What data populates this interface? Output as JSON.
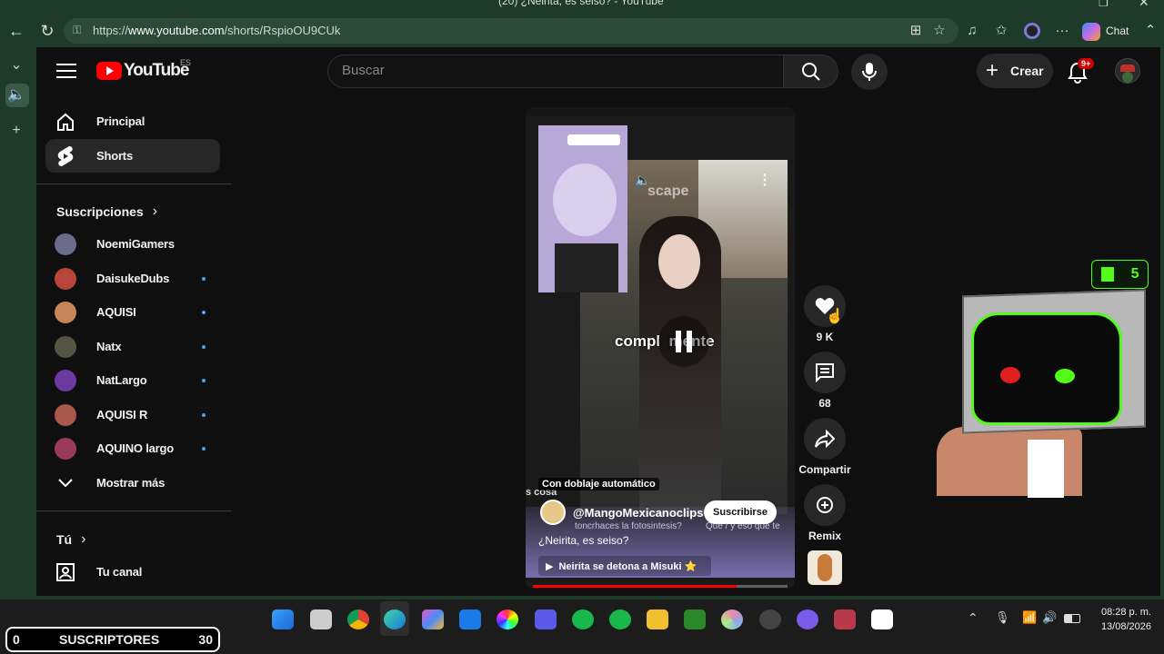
{
  "browser": {
    "tab_title": "(20) ¿Neirita, es seiso? - YouTube",
    "url": "https://www.youtube.com/shorts/RspioOU9CUk",
    "url_host": "www.youtube.com",
    "chat_label": "Chat"
  },
  "youtube": {
    "logo_text": "YouTube",
    "country": "ES",
    "search_placeholder": "Buscar",
    "create_label": "Crear",
    "notif_badge": "9+"
  },
  "sidebar": {
    "main": [
      {
        "label": "Principal",
        "icon": "home-icon"
      },
      {
        "label": "Shorts",
        "icon": "shorts-icon",
        "active": true
      }
    ],
    "subscriptions_title": "Suscripciones",
    "subscriptions": [
      {
        "label": "NoemiGamers",
        "dot": false,
        "color": "#6b6b8a"
      },
      {
        "label": "DaisukeDubs",
        "dot": true,
        "color": "#b8443a"
      },
      {
        "label": "AQUISI",
        "dot": true,
        "color": "#c9845a"
      },
      {
        "label": "Natx",
        "dot": true,
        "color": "#555544"
      },
      {
        "label": "NatLargo",
        "dot": true,
        "color": "#6a3aa0"
      },
      {
        "label": "AQUISI R",
        "dot": true,
        "color": "#a85a4a"
      },
      {
        "label": "AQUINO largo",
        "dot": true,
        "color": "#9a3a5a"
      }
    ],
    "show_more": "Mostrar más",
    "you_title": "Tú",
    "your_channel": "Tu canal"
  },
  "short": {
    "watermark": "scape",
    "caption": "compl  mente",
    "dub_label": "Con doblaje automático",
    "channel": "@MangoMexicanoclips",
    "subscribe": "Suscribirse",
    "title": "¿Neirita, es seiso?",
    "playlist": "Neirita se detona a Misuki ⭐",
    "overlay_text": "s cosa",
    "overlay_small1": "toncrhaces la fotosintesis?",
    "overlay_small2": "Qué / y eso que te",
    "progress": 0.8
  },
  "actions": {
    "likes": "9 K",
    "comments": "68",
    "share": "Compartir",
    "remix": "Remix"
  },
  "overlay_stream": {
    "kick_count": "5",
    "sub_counter_left": "0",
    "sub_counter_label": "SUSCRIPTORES",
    "sub_counter_right": "30"
  },
  "taskbar": {
    "time": "08:28 p. m.",
    "date": "13/08/2026"
  },
  "colors": {
    "yt_red": "#ff0000",
    "chrome_green": "#1e3a2a",
    "dot_blue": "#3ea6ff",
    "kick_green": "#53fc18"
  }
}
